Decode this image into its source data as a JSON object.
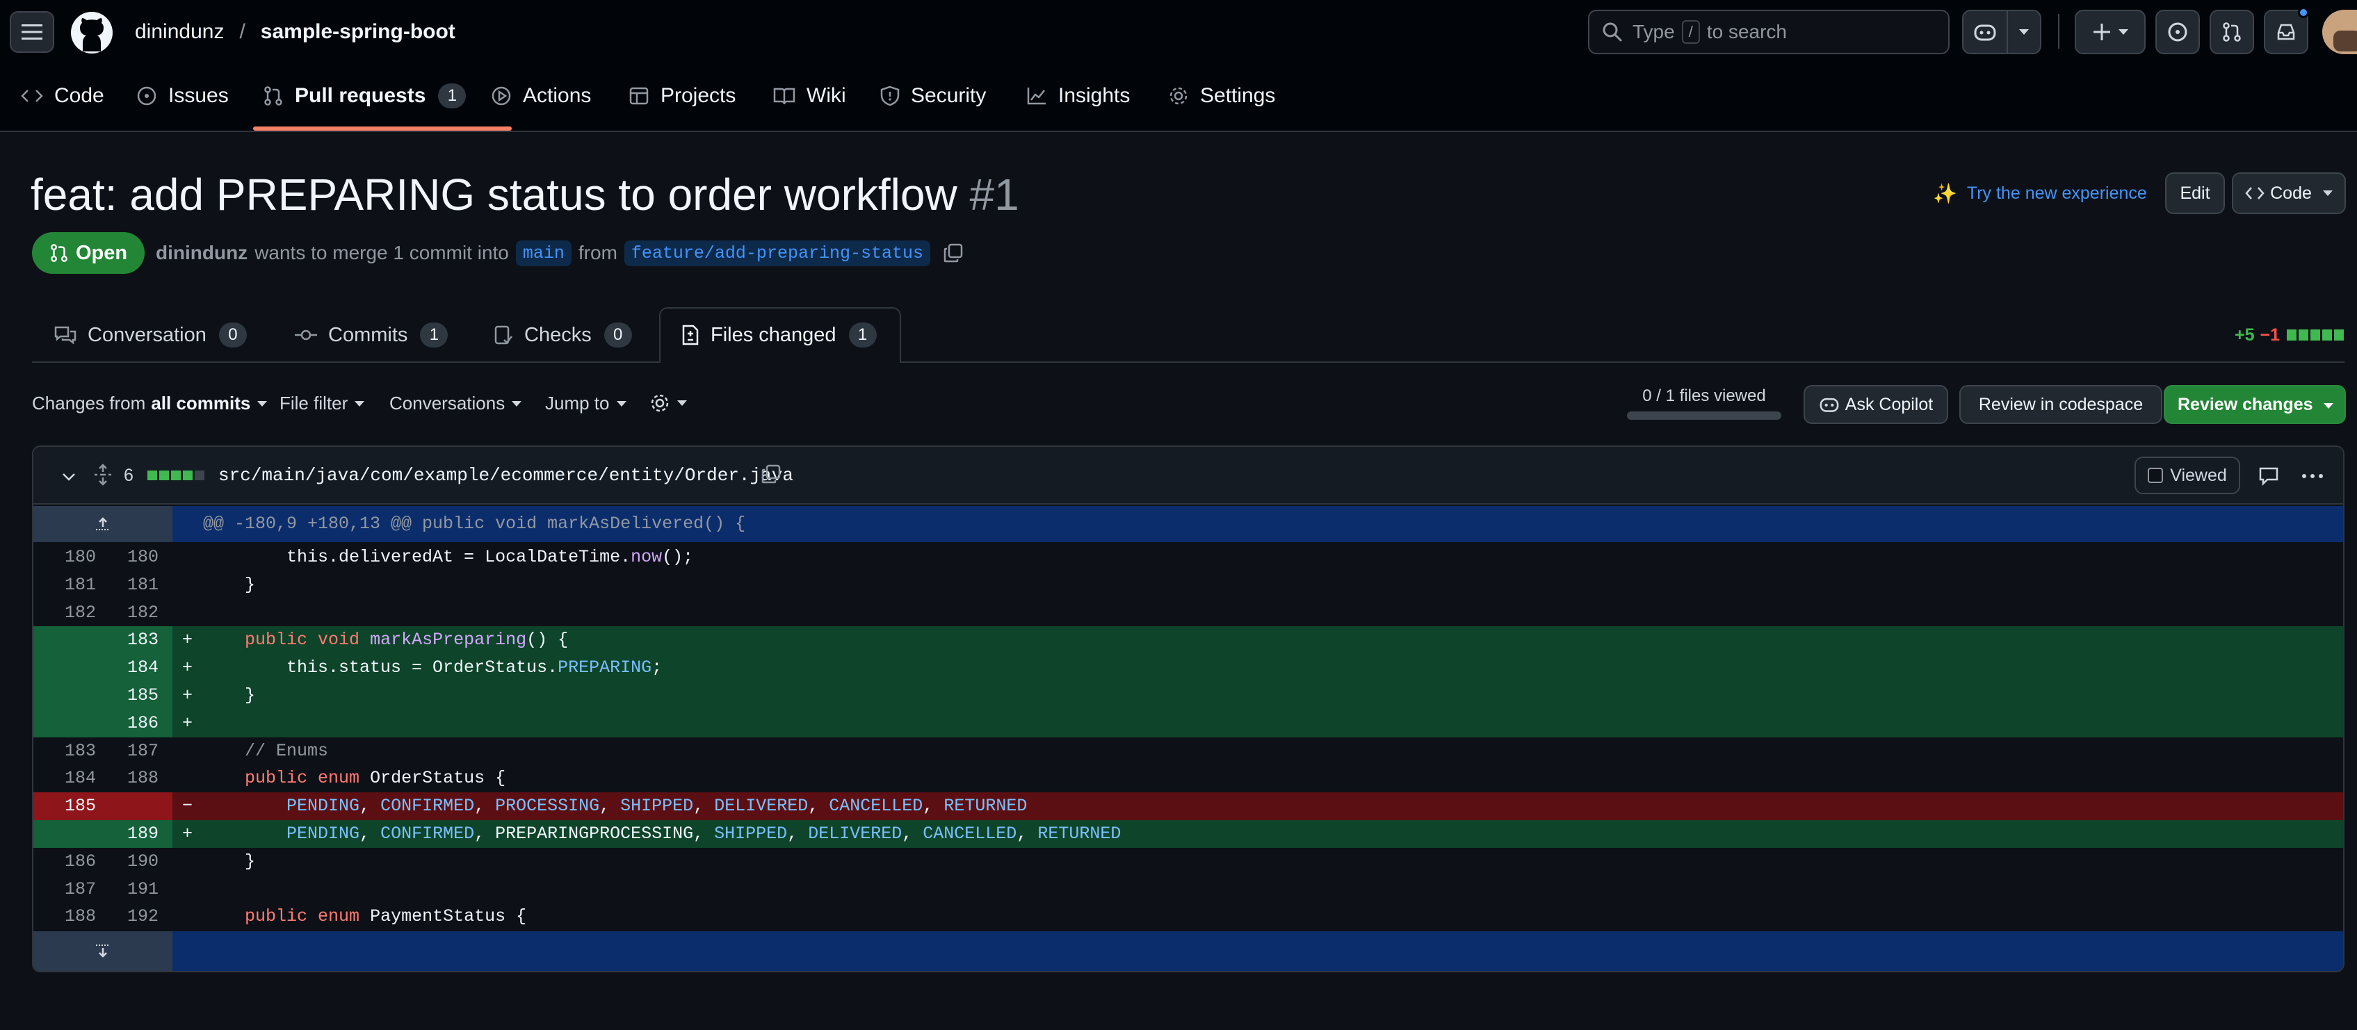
{
  "header": {
    "owner": "dinindunz",
    "separator": "/",
    "repo": "sample-spring-boot",
    "search_prefix": "Type",
    "search_key": "/",
    "search_suffix": "to search"
  },
  "repo_nav": {
    "code": "Code",
    "issues": "Issues",
    "pull_requests": "Pull requests",
    "pull_requests_count": "1",
    "actions": "Actions",
    "projects": "Projects",
    "wiki": "Wiki",
    "security": "Security",
    "insights": "Insights",
    "settings": "Settings"
  },
  "pr": {
    "title": "feat: add PREPARING status to order workflow",
    "number": "#1",
    "try_new": "Try the new experience",
    "edit": "Edit",
    "code_btn": "Code",
    "state": "Open",
    "author": "dinindunz",
    "merge_text": "wants to merge 1 commit into",
    "base": "main",
    "from": "from",
    "head": "feature/add-preparing-status"
  },
  "pr_tabs": {
    "conversation": "Conversation",
    "conversation_count": "0",
    "commits": "Commits",
    "commits_count": "1",
    "checks": "Checks",
    "checks_count": "0",
    "files_changed": "Files changed",
    "files_changed_count": "1",
    "additions": "+5",
    "deletions": "−1"
  },
  "toolbar": {
    "changes_from": "Changes from",
    "all_commits": "all commits",
    "file_filter": "File filter",
    "conversations": "Conversations",
    "jump_to": "Jump to",
    "files_viewed": "0 / 1 files viewed",
    "files_viewed_progress": 0,
    "ask_copilot": "Ask Copilot",
    "review_codespace": "Review in codespace",
    "review_changes": "Review changes"
  },
  "file": {
    "changes": "6",
    "path": "src/main/java/com/example/ecommerce/entity/Order.java",
    "viewed": "Viewed",
    "hunk": "@@ -180,9 +180,13 @@ public void markAsDelivered() {"
  },
  "diff_lines": [
    {
      "type": "ctx",
      "old": "180",
      "new": "180",
      "text": "        this.deliveredAt = LocalDateTime.now();"
    },
    {
      "type": "ctx",
      "old": "181",
      "new": "181",
      "text": "    }"
    },
    {
      "type": "ctx",
      "old": "182",
      "new": "182",
      "text": ""
    },
    {
      "type": "add",
      "old": "",
      "new": "183",
      "text": "    public void markAsPreparing() {"
    },
    {
      "type": "add",
      "old": "",
      "new": "184",
      "text": "        this.status = OrderStatus.PREPARING;"
    },
    {
      "type": "add",
      "old": "",
      "new": "185",
      "text": "    }"
    },
    {
      "type": "add",
      "old": "",
      "new": "186",
      "text": ""
    },
    {
      "type": "ctx",
      "old": "183",
      "new": "187",
      "text": "    // Enums"
    },
    {
      "type": "ctx",
      "old": "184",
      "new": "188",
      "text": "    public enum OrderStatus {"
    },
    {
      "type": "del",
      "old": "185",
      "new": "",
      "text": "        PENDING, CONFIRMED, PROCESSING, SHIPPED, DELIVERED, CANCELLED, RETURNED"
    },
    {
      "type": "add",
      "old": "",
      "new": "189",
      "text": "        PENDING, CONFIRMED, PREPARING, PROCESSING, SHIPPED, DELIVERED, CANCELLED, RETURNED"
    },
    {
      "type": "ctx",
      "old": "186",
      "new": "190",
      "text": "    }"
    },
    {
      "type": "ctx",
      "old": "187",
      "new": "191",
      "text": ""
    },
    {
      "type": "ctx",
      "old": "188",
      "new": "192",
      "text": "    public enum PaymentStatus {"
    }
  ],
  "colors": {
    "accent_blue": "#4493f8",
    "open_green": "#238636",
    "add_bg": "#0e4429",
    "del_bg": "#5c0f12",
    "underline": "#f78166"
  }
}
